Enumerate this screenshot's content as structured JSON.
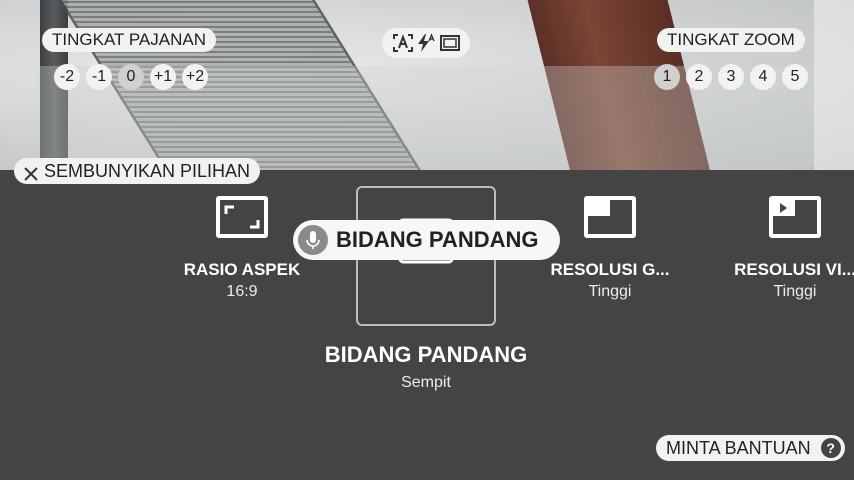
{
  "exposure": {
    "label": "TINGKAT PAJANAN",
    "levels": [
      "-2",
      "-1",
      "0",
      "+1",
      "+2"
    ],
    "selected": "0"
  },
  "zoom": {
    "label": "TINGKAT ZOOM",
    "levels": [
      "1",
      "2",
      "3",
      "4",
      "5"
    ],
    "selected": "1"
  },
  "modes": {
    "icons": [
      "auto-mode-icon",
      "flash-auto-icon",
      "viewfinder-frame-icon"
    ]
  },
  "hide_options": {
    "label": "SEMBUNYIKAN PILIHAN"
  },
  "options": [
    {
      "label": "RASIO ASPEK",
      "value": "16:9",
      "icon": "aspect-ratio-icon"
    },
    {
      "label": "BIDANG PANDANG",
      "value": "Sempit",
      "icon": "field-of-view-icon"
    },
    {
      "label": "RESOLUSI G...",
      "value": "Tinggi",
      "icon": "image-resolution-icon"
    },
    {
      "label": "RESOLUSI VI...",
      "value": "Tinggi",
      "icon": "video-resolution-icon"
    }
  ],
  "voice": {
    "text": "BIDANG PANDANG"
  },
  "selected_option": {
    "title": "BIDANG PANDANG",
    "value": "Sempit"
  },
  "help": {
    "label": "MINTA BANTUAN",
    "icon_text": "?"
  }
}
